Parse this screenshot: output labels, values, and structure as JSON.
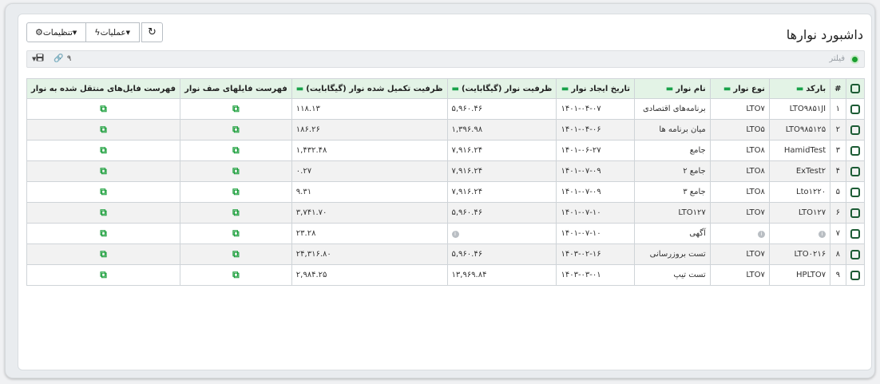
{
  "page": {
    "title": "داشبورد نوارها"
  },
  "toolbar": {
    "settings_label": "تنظیمات",
    "operations_label": "عملیات"
  },
  "filter": {
    "label": "فیلتر",
    "count": "۹"
  },
  "columns": [
    "#",
    "بارکد",
    "نوع نوار",
    "نام نوار",
    "تاریخ ایجاد نوار",
    "ظرفیت نوار (گیگابایت)",
    "ظرفیت تکمیل شده نوار (گیگابایت)",
    "فهرست فایلهای صف نوار",
    "فهرست فایل‌های منتقل شده به نوار"
  ],
  "rows": [
    {
      "idx": "۱",
      "barcode": "LTO۹۸۵۱JI",
      "type": "LTO۷",
      "name": "برنامه‌های اقتصادی",
      "date": "۱۴۰۱-۰۴-۰۷",
      "capacity": "۵,۹۶۰.۴۶",
      "used": "۱۱۸.۱۳"
    },
    {
      "idx": "۲",
      "barcode": "LTO۹۸۵۱۲۵",
      "type": "LTO۵",
      "name": "میان برنامه ها",
      "date": "۱۴۰۱-۰۴-۰۶",
      "capacity": "۱,۳۹۶.۹۸",
      "used": "۱۸۶.۲۶"
    },
    {
      "idx": "۳",
      "barcode": "HamidTest",
      "type": "LTO۸",
      "name": "جامع",
      "date": "۱۴۰۱-۰۶-۲۷",
      "capacity": "۷,۹۱۶.۲۴",
      "used": "۱,۴۳۲.۴۸"
    },
    {
      "idx": "۴",
      "barcode": "ExTest۲",
      "type": "LTO۸",
      "name": "جامع ۲",
      "date": "۱۴۰۱-۰۷-۰۹",
      "capacity": "۷,۹۱۶.۲۴",
      "used": "۰.۲۷"
    },
    {
      "idx": "۵",
      "barcode": "Lto۱۲۲۰",
      "type": "LTO۸",
      "name": "جامع ۳",
      "date": "۱۴۰۱-۰۷-۰۹",
      "capacity": "۷,۹۱۶.۲۴",
      "used": "۹.۳۱"
    },
    {
      "idx": "۶",
      "barcode": "LTO۱۲۷",
      "type": "LTO۷",
      "name": "LTO۱۲۷",
      "date": "۱۴۰۱-۰۷-۱۰",
      "capacity": "۵,۹۶۰.۴۶",
      "used": "۳,۷۴۱.۷۰"
    },
    {
      "idx": "۷",
      "barcode": "",
      "type": "",
      "name": "آگهی",
      "date": "۱۴۰۱-۰۷-۱۰",
      "capacity": "",
      "used": "۲۳.۲۸"
    },
    {
      "idx": "۸",
      "barcode": "LTO۰۲۱۶",
      "type": "LTO۷",
      "name": "تست بروزرسانی",
      "date": "۱۴۰۳-۰۲-۱۶",
      "capacity": "۵,۹۶۰.۴۶",
      "used": "۲۴,۳۱۶.۸۰"
    },
    {
      "idx": "۹",
      "barcode": "HPLTO۷",
      "type": "LTO۷",
      "name": "تست تیپ",
      "date": "۱۴۰۳-۰۳-۰۱",
      "capacity": "۱۳,۹۶۹.۸۴",
      "used": "۲,۹۸۴.۲۵"
    }
  ],
  "colors": {
    "accent": "#19a24a",
    "header_bg": "#e3f3e6"
  }
}
